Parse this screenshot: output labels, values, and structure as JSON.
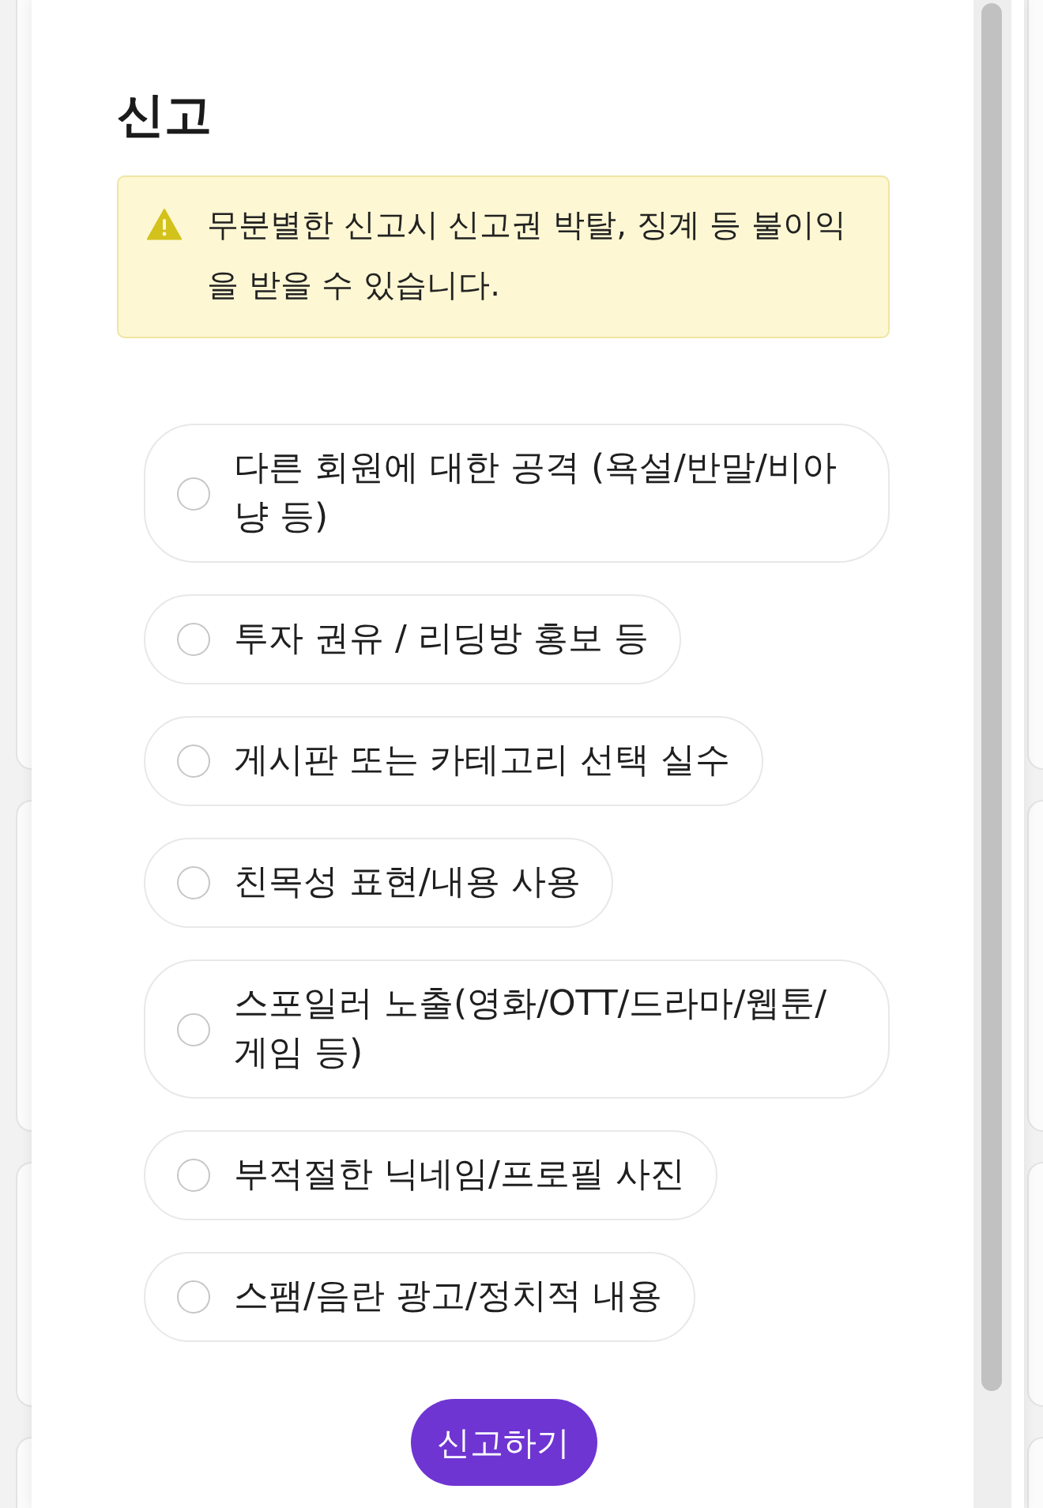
{
  "dialog": {
    "title": "신고",
    "warning": {
      "text": "무분별한 신고시 신고권 박탈, 징계 등 불이익을 받을 수 있습니다."
    },
    "options": [
      {
        "label": "다른 회원에 대한 공격 (욕설/반말/비아냥 등)",
        "selected": false
      },
      {
        "label": "투자 권유 / 리딩방 홍보 등",
        "selected": false
      },
      {
        "label": "게시판 또는 카테고리 선택 실수",
        "selected": false
      },
      {
        "label": "친목성 표현/내용 사용",
        "selected": false
      },
      {
        "label": "스포일러 노출(영화/OTT/드라마/웹툰/게임 등)",
        "selected": false
      },
      {
        "label": "부적절한 닉네임/프로필 사진",
        "selected": false
      },
      {
        "label": "스팸/음란 광고/정치적 내용",
        "selected": false
      }
    ],
    "submit_button": {
      "label": "신고하기"
    }
  }
}
